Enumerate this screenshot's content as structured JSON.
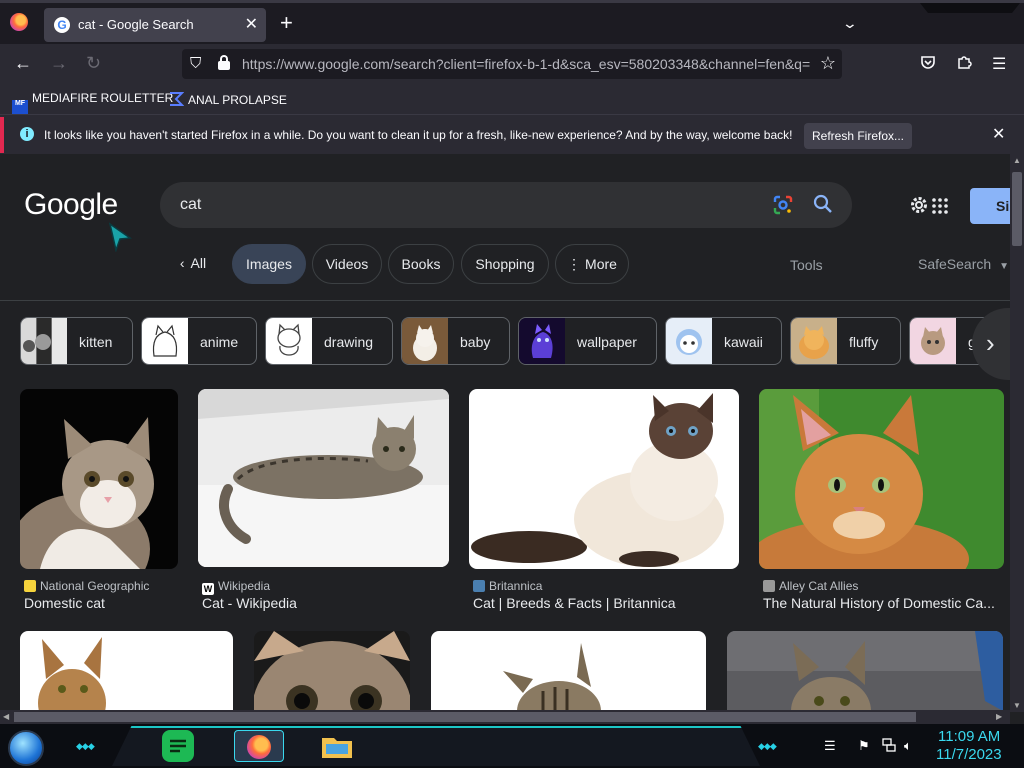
{
  "browser": {
    "tab": {
      "title": "cat - Google Search",
      "favicon_letter": "G"
    },
    "url": "https://www.google.com/search?client=firefox-b-1-d&sca_esv=580203348&channel=fen&q=",
    "bookmarks": [
      {
        "label": "MEDIAFIRE ROULETTER",
        "icon_text": "MF"
      },
      {
        "label": "ANAL PROLAPSE"
      }
    ],
    "notification": {
      "text": "It looks like you haven't started Firefox in a while. Do you want to clean it up for a fresh, like-new experience? And by the way, welcome back!",
      "button": "Refresh Firefox..."
    }
  },
  "google": {
    "logo": "Google",
    "query": "cat",
    "signin": "Si",
    "tabs": [
      {
        "label": "All"
      },
      {
        "label": "Images",
        "active": true
      },
      {
        "label": "Videos"
      },
      {
        "label": "Books"
      },
      {
        "label": "Shopping"
      },
      {
        "label": "More"
      }
    ],
    "tools": "Tools",
    "safesearch": "SafeSearch",
    "chips": [
      "kitten",
      "anime",
      "drawing",
      "baby",
      "wallpaper",
      "kawaii",
      "fluffy",
      "g"
    ],
    "results": [
      {
        "source": "National Geographic",
        "title": "Domestic cat"
      },
      {
        "source": "Wikipedia",
        "title": "Cat - Wikipedia",
        "favicon_letter": "W"
      },
      {
        "source": "Britannica",
        "title": "Cat | Breeds & Facts | Britannica"
      },
      {
        "source": "Alley Cat Allies",
        "title": "The Natural History of Domestic Ca..."
      }
    ]
  },
  "taskbar": {
    "time": "11:09 AM",
    "date": "11/7/2023"
  },
  "colors": {
    "accent": "#8ab4f8",
    "notice_accent": "#e22850",
    "clock": "#3ad8ee"
  }
}
